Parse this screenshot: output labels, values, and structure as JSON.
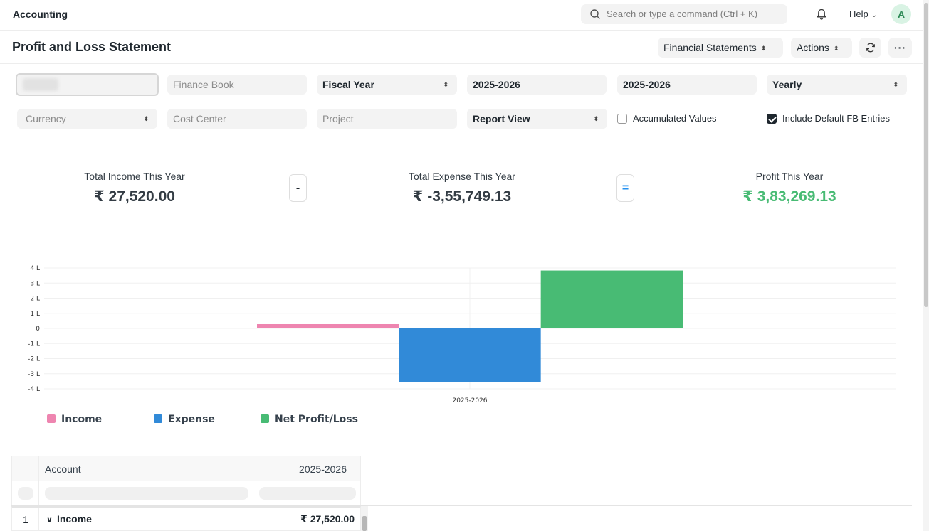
{
  "navbar": {
    "brand": "Accounting",
    "search_placeholder": "Search or type a command (Ctrl + K)",
    "help_label": "Help",
    "avatar_initial": "A"
  },
  "page": {
    "title": "Profit and Loss Statement",
    "financial_statements_label": "Financial Statements",
    "actions_label": "Actions"
  },
  "filters": {
    "finance_book_placeholder": "Finance Book",
    "period_type": "Fiscal Year",
    "from_year": "2025-2026",
    "to_year": "2025-2026",
    "periodicity": "Yearly",
    "currency_placeholder": "Currency",
    "cost_center_placeholder": "Cost Center",
    "project_placeholder": "Project",
    "report_view": "Report View",
    "accumulated_values_label": "Accumulated Values",
    "accumulated_values_checked": false,
    "include_default_fb_label": "Include Default FB Entries",
    "include_default_fb_checked": true
  },
  "summary": {
    "income_label": "Total Income This Year",
    "income_value": "₹ 27,520.00",
    "minus_op": "-",
    "expense_label": "Total Expense This Year",
    "expense_value": "₹ -3,55,749.13",
    "equals_op": "=",
    "profit_label": "Profit This Year",
    "profit_value": "₹ 3,83,269.13",
    "profit_color": "#48bb74"
  },
  "chart_data": {
    "type": "bar",
    "categories": [
      "2025-2026"
    ],
    "series": [
      {
        "name": "Income",
        "values": [
          27520.0
        ],
        "color": "#ee85b0"
      },
      {
        "name": "Expense",
        "values": [
          -355749.13
        ],
        "color": "#318ad8"
      },
      {
        "name": "Net Profit/Loss",
        "values": [
          383269.13
        ],
        "color": "#48bb74"
      }
    ],
    "ylim": [
      -400000,
      400000
    ],
    "y_ticks": [
      400000,
      300000,
      200000,
      100000,
      0,
      -100000,
      -200000,
      -300000,
      -400000
    ],
    "y_tick_labels": [
      "4 L",
      "3 L",
      "2 L",
      "1 L",
      "0",
      "-1 L",
      "-2 L",
      "-3 L",
      "-4 L"
    ],
    "grid": true,
    "legend_position": "bottom-left"
  },
  "table": {
    "col_account": "Account",
    "col_period": "2025-2026",
    "rows": [
      {
        "num": "1",
        "account": "Income",
        "value": "₹ 27,520.00"
      }
    ]
  }
}
